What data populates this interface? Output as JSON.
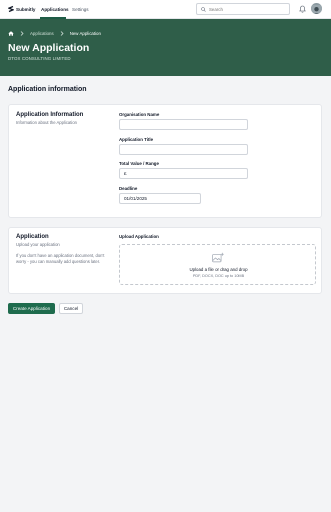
{
  "app": {
    "name": "Submitly"
  },
  "nav": {
    "tabs": [
      {
        "label": "Applications",
        "active": true
      },
      {
        "label": "Settings",
        "active": false
      }
    ]
  },
  "search": {
    "placeholder": "Search"
  },
  "icons": {
    "logo": "submitly-logo",
    "search": "search-icon",
    "notifications": "bell-icon",
    "avatar": "user-avatar",
    "home": "home-icon",
    "separator": "chevron-right-icon",
    "upload": "image-upload-icon"
  },
  "breadcrumb": {
    "items": [
      "Applications",
      "New Application"
    ]
  },
  "header": {
    "title": "New Application",
    "subtitle": "DTOX CONSULTING LIMITED"
  },
  "section": {
    "title": "Application information"
  },
  "info_card": {
    "title": "Application Information",
    "description": "Information about the Application",
    "fields": [
      {
        "label": "Organisation Name",
        "value": ""
      },
      {
        "label": "Application Title",
        "value": ""
      },
      {
        "label": "Total Value / Range",
        "value": "£"
      },
      {
        "label": "Deadline",
        "value": "01/01/2025"
      }
    ]
  },
  "upload_card": {
    "title": "Application",
    "description": "Upload your application",
    "note": "If you don't have an application document, don't worry - you can manually add questions later.",
    "upload_label": "Upload Application",
    "dropzone_text": "Upload a file or drag and drop",
    "dropzone_hint": "PDF, DOCX, DOC up to 10MB"
  },
  "actions": {
    "create": "Create Application",
    "cancel": "Cancel"
  },
  "colors": {
    "brand": "#2f5e49",
    "primary_button": "#1e6b4d"
  }
}
